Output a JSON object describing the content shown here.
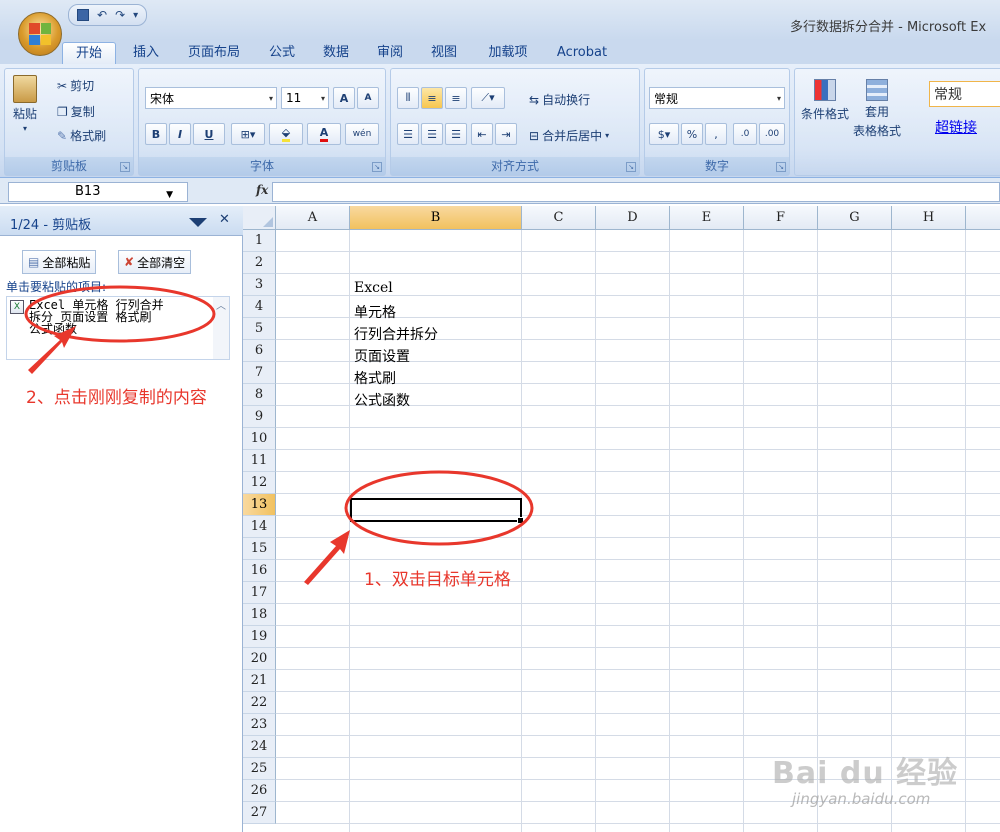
{
  "window": {
    "title": "多行数据拆分合并 - Microsoft Ex",
    "qat": {
      "save_icon": "save-icon",
      "undo": "↶",
      "redo": "↷",
      "more": "▾"
    }
  },
  "tabs": [
    "开始",
    "插入",
    "页面布局",
    "公式",
    "数据",
    "审阅",
    "视图",
    "加载项",
    "Acrobat"
  ],
  "ribbon": {
    "clipboard": {
      "label": "剪贴板",
      "paste": "粘贴",
      "cut": "剪切",
      "copy": "复制",
      "format_painter": "格式刷"
    },
    "font": {
      "label": "字体",
      "name": "宋体",
      "size": "11",
      "bold": "B",
      "italic": "I",
      "underline": "U",
      "grow": "A",
      "shrink": "A",
      "font_color": "A",
      "phonetic": "wén"
    },
    "alignment": {
      "label": "对齐方式",
      "wrap": "自动换行",
      "merge": "合并后居中"
    },
    "number": {
      "label": "数字",
      "format": "常规",
      "percent": "%",
      "comma": ",",
      "inc": ".0",
      "dec": ".00"
    },
    "styles": {
      "conditional": "条件格式",
      "table_format_line1": "套用",
      "table_format_line2": "表格格式",
      "normal": "常规",
      "hyperlink": "超链接"
    }
  },
  "formula_bar": {
    "name_box": "B13",
    "fx": "fx",
    "value": ""
  },
  "clipboard_pane": {
    "title": "1/24 - 剪贴板",
    "paste_all": "全部粘贴",
    "clear_all": "全部清空",
    "hint": "单击要粘贴的项目:",
    "item_lines": [
      "Excel 单元格 行列合并",
      "拆分 页面设置 格式刷",
      "公式函数"
    ]
  },
  "sheet": {
    "columns": [
      "A",
      "B",
      "C",
      "D",
      "E",
      "F",
      "G",
      "H"
    ],
    "rows": [
      "1",
      "2",
      "3",
      "4",
      "5",
      "6",
      "7",
      "8",
      "9",
      "10",
      "11",
      "12",
      "13",
      "14",
      "15",
      "16",
      "17",
      "18",
      "19",
      "20",
      "21",
      "22",
      "23",
      "24",
      "25",
      "26",
      "27"
    ],
    "selected_column": "B",
    "selected_row": "13",
    "cells_B": [
      {
        "row": "3",
        "value": "Excel"
      },
      {
        "row": "4",
        "value": "单元格"
      },
      {
        "row": "5",
        "value": "行列合并拆分"
      },
      {
        "row": "6",
        "value": "页面设置"
      },
      {
        "row": "7",
        "value": "格式刷"
      },
      {
        "row": "8",
        "value": "公式函数"
      }
    ]
  },
  "annotations": {
    "step1": "1、双击目标单元格",
    "step2": "2、点击刚刚复制的内容",
    "color": "#e8372c"
  },
  "watermark": {
    "logo": "Bai du 经验",
    "url": "jingyan.baidu.com"
  }
}
